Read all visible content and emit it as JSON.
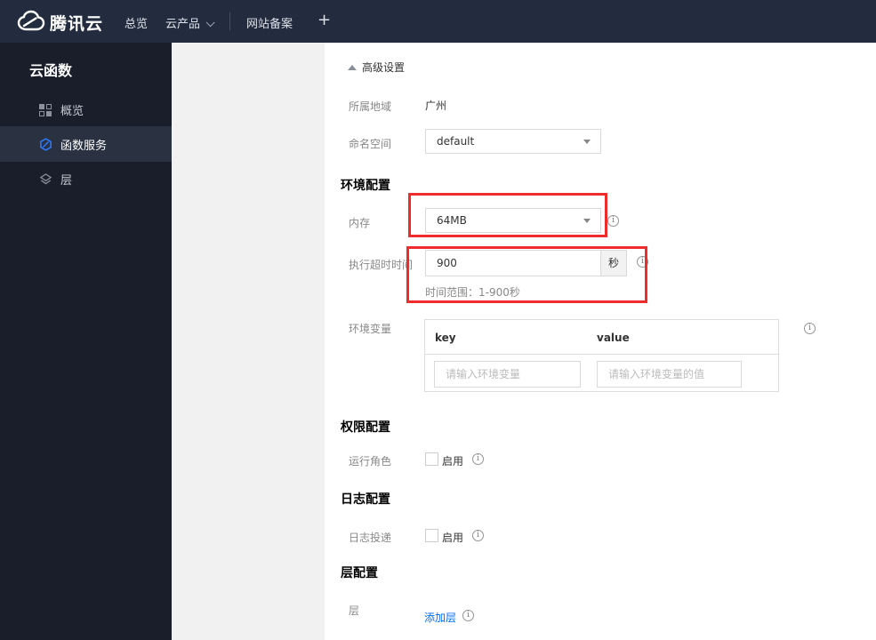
{
  "topbar": {
    "brand": "腾讯云",
    "nav": [
      {
        "label": "总览"
      },
      {
        "label": "云产品"
      },
      {
        "label": "网站备案"
      }
    ],
    "plus_label": "+"
  },
  "sidebar": {
    "title": "云函数",
    "items": [
      {
        "label": "概览",
        "icon": "grid-icon",
        "active": false
      },
      {
        "label": "函数服务",
        "icon": "scf-hexagon-icon",
        "active": true
      },
      {
        "label": "层",
        "icon": "layers-icon",
        "active": false
      }
    ]
  },
  "content": {
    "advanced_toggle_label": "高级设置",
    "region": {
      "label": "所属地域",
      "value": "广州"
    },
    "namespace": {
      "label": "命名空间",
      "value": "default"
    },
    "section_env": "环境配置",
    "memory": {
      "label": "内存",
      "value": "64MB"
    },
    "timeout": {
      "label": "执行超时时间",
      "value": "900",
      "unit": "秒",
      "hint": "时间范围：1-900秒"
    },
    "env_vars": {
      "label": "环境变量",
      "key_header": "key",
      "value_header": "value",
      "key_placeholder": "请输入环境变量",
      "value_placeholder": "请输入环境变量的值"
    },
    "section_perm": "权限配置",
    "role": {
      "label": "运行角色",
      "checkbox_label": "启用",
      "checked": false
    },
    "section_log": "日志配置",
    "log_delivery": {
      "label": "日志投递",
      "checkbox_label": "启用",
      "checked": false
    },
    "section_layer": "层配置",
    "layer": {
      "label": "层",
      "add_link_label": "添加层"
    }
  },
  "colors": {
    "topbar_bg": "#222c3e",
    "sidebar_bg": "#191e2a",
    "sidebar_active_bg": "#2a3242",
    "panel_gray": "#f1f1f1",
    "accent_blue": "#006eff",
    "annotation_red": "#ee2c2c"
  }
}
